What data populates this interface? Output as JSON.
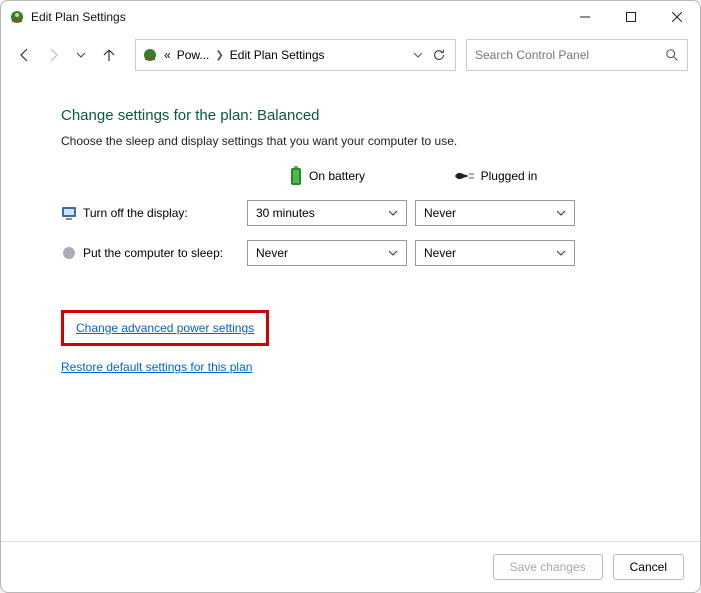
{
  "window": {
    "title": "Edit Plan Settings"
  },
  "breadcrumb": {
    "seg1": "Pow...",
    "seg2": "Edit Plan Settings"
  },
  "search": {
    "placeholder": "Search Control Panel"
  },
  "main": {
    "heading": "Change settings for the plan: Balanced",
    "subtext": "Choose the sleep and display settings that you want your computer to use.",
    "col_battery": "On battery",
    "col_plugged": "Plugged in",
    "row_display_label": "Turn off the display:",
    "row_display_battery": "30 minutes",
    "row_display_plugged": "Never",
    "row_sleep_label": "Put the computer to sleep:",
    "row_sleep_battery": "Never",
    "row_sleep_plugged": "Never",
    "link_advanced": "Change advanced power settings",
    "link_restore": "Restore default settings for this plan"
  },
  "footer": {
    "save": "Save changes",
    "cancel": "Cancel"
  }
}
